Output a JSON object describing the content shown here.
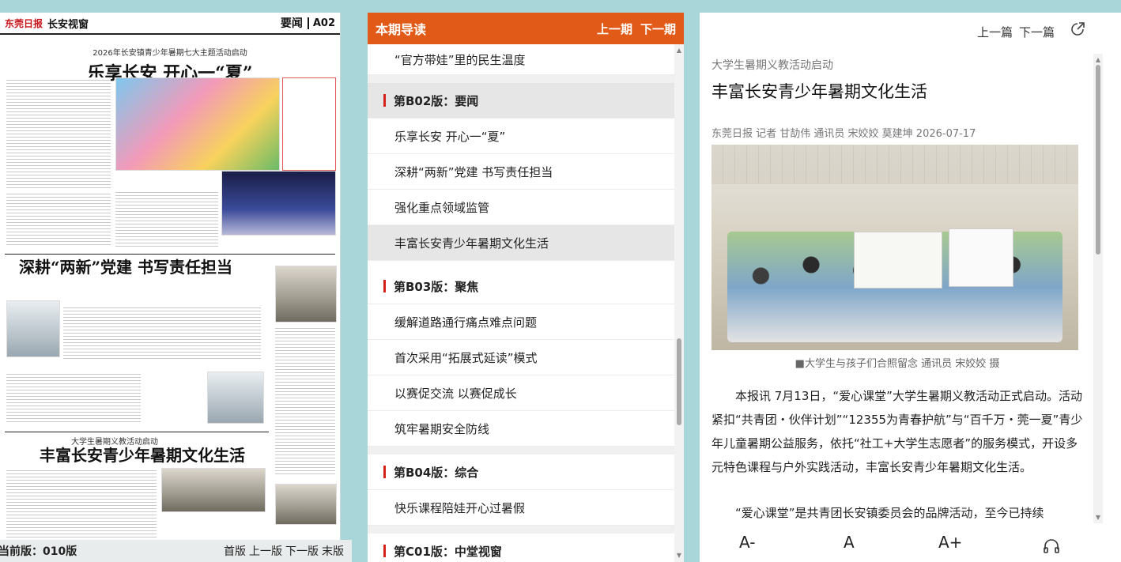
{
  "paper": {
    "logo": "东莞日报",
    "page_name": "长安视窗",
    "section": "要闻",
    "page_no": "A02",
    "story1": {
      "kicker": "2026年长安镇青少年暑期七大主题活动启动",
      "headline": "乐享长安  开心一“夏”"
    },
    "story2": {
      "headline": "深耕“两新”党建  书写责任担当"
    },
    "story3": {
      "kicker": "大学生暑期义教活动启动",
      "headline": "丰富长安青少年暑期文化生活"
    }
  },
  "statusbar": {
    "current": "当前版：010版",
    "nav": [
      "首版",
      "上一版",
      "下一版",
      "末版"
    ]
  },
  "guide": {
    "title": "本期导读",
    "prev": "上一期",
    "next": "下一期",
    "top_item": "“官方带娃”里的民生温度",
    "sections": [
      {
        "name": "第B02版：要闻",
        "items": [
          "乐享长安 开心一“夏”",
          "深耕“两新”党建 书写责任担当",
          "强化重点领域监管",
          "丰富长安青少年暑期文化生活"
        ]
      },
      {
        "name": "第B03版：聚焦",
        "items": [
          "缓解道路通行痛点难点问题",
          "首次采用“拓展式延读”模式",
          "以赛促交流 以赛促成长",
          "筑牢暑期安全防线"
        ]
      },
      {
        "name": "第B04版：综合",
        "items": [
          "快乐课程陪娃开心过暑假"
        ]
      },
      {
        "name": "第C01版：中堂视窗",
        "items": []
      }
    ]
  },
  "article": {
    "prev": "上一篇",
    "next": "下一篇",
    "subtitle": "大学生暑期义教活动启动",
    "title": "丰富长安青少年暑期文化生活",
    "byline": "东莞日报 记者 甘劼伟 通讯员 宋姣姣 莫建坤 2026-07-17",
    "caption": "■大学生与孩子们合照留念 通讯员 宋姣姣 摄",
    "para1": "本报讯 7月13日，“爱心课堂”大学生暑期义教活动正式启动。活动紧扣“共青团・伙伴计划”“12355为青春护航”与“百千万・莞一夏”青少年儿童暑期公益服务，依托“社工+大学生志愿者”的服务模式，开设多元特色课程与户外实践活动，丰富长安青少年暑期文化生活。",
    "para2": "“爱心课堂”是共青团长安镇委员会的品牌活动，至今已持续",
    "tools": {
      "smaller": "A-",
      "normal": "A",
      "larger": "A+"
    }
  }
}
